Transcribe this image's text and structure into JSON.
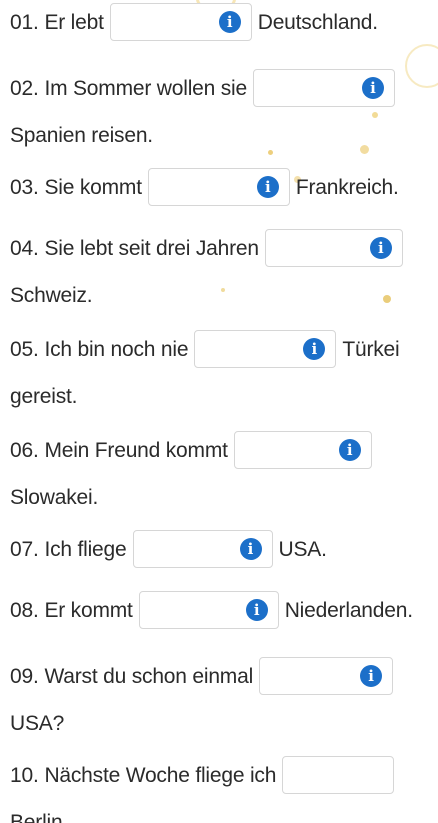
{
  "exercises": [
    {
      "num": "01.",
      "before": "Er lebt",
      "after": "Deutschland.",
      "after_on_new_line": false,
      "has_info": true
    },
    {
      "num": "02.",
      "before": "Im Sommer wollen sie",
      "after": "Spanien reisen.",
      "after_on_new_line": true,
      "has_info": true
    },
    {
      "num": "03.",
      "before": "Sie kommt",
      "after": "Frankreich.",
      "after_on_new_line": false,
      "has_info": true
    },
    {
      "num": "04.",
      "before": "Sie lebt seit drei Jahren",
      "after": "Schweiz.",
      "after_on_new_line": true,
      "has_info": true
    },
    {
      "num": "05.",
      "before": "Ich bin noch nie",
      "after": "Türkei",
      "after_line2": "gereist.",
      "after_on_new_line": false,
      "has_info": true
    },
    {
      "num": "06.",
      "before": "Mein Freund kommt",
      "after": "Slowakei.",
      "after_on_new_line": true,
      "has_info": true
    },
    {
      "num": "07.",
      "before": "Ich fliege",
      "after": "USA.",
      "after_on_new_line": false,
      "has_info": true
    },
    {
      "num": "08.",
      "before": "Er kommt",
      "after": "Niederlanden.",
      "after_on_new_line": false,
      "has_info": true
    },
    {
      "num": "09.",
      "before": "Warst du schon einmal",
      "after": "USA?",
      "after_on_new_line": true,
      "has_info": true
    },
    {
      "num": "10.",
      "before": "Nächste Woche fliege ich",
      "after": "Berlin.",
      "after_on_new_line": true,
      "has_info": false
    }
  ],
  "colors": {
    "text": "#2b2b2b",
    "input_border": "#d6d6d6",
    "info_icon": "#1c6fc9",
    "decoration_gold": "#e9c766"
  },
  "icons": {
    "info": "info-circle-icon"
  }
}
